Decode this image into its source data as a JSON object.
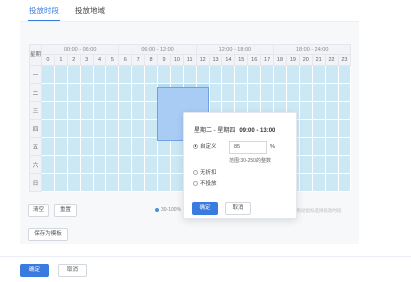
{
  "tabs": [
    {
      "label": "投放时段",
      "active": true
    },
    {
      "label": "投放地域",
      "active": false
    }
  ],
  "schedule": {
    "corner_label": "星期",
    "period_groups": [
      "00:00 - 06:00",
      "06:00 - 12:00",
      "12:00 - 18:00",
      "18:00 - 24:00"
    ],
    "hours": [
      "0",
      "1",
      "2",
      "3",
      "4",
      "5",
      "6",
      "7",
      "8",
      "9",
      "10",
      "11",
      "12",
      "13",
      "14",
      "15",
      "16",
      "17",
      "18",
      "19",
      "20",
      "21",
      "22",
      "23"
    ],
    "days": [
      "一",
      "二",
      "三",
      "四",
      "五",
      "六",
      "日"
    ],
    "selected": {
      "days": [
        "二",
        "三",
        "四"
      ],
      "hours": [
        "9",
        "10",
        "11",
        "12"
      ]
    }
  },
  "actions": {
    "clear": "清空",
    "reset": "重置",
    "save_template": "保存为模板"
  },
  "legend": {
    "label": "30-100%",
    "color": "#4a90d9"
  },
  "hint": "可拖动鼠标选择投放时段",
  "popover": {
    "range_prefix": "星期二 - 星期四",
    "time_range": "09:00 - 13:00",
    "custom_label": "自定义",
    "custom_value": "85",
    "unit": "%",
    "range_note": "范围:30-250的整数",
    "no_discount": "无折扣",
    "no_delivery": "不投放",
    "confirm": "确定",
    "cancel": "取消"
  },
  "footer": {
    "confirm": "确定",
    "cancel": "取消"
  },
  "colors": {
    "primary": "#3a7be0",
    "cell": "#cde8f5",
    "selection": "#a9ccf5"
  }
}
